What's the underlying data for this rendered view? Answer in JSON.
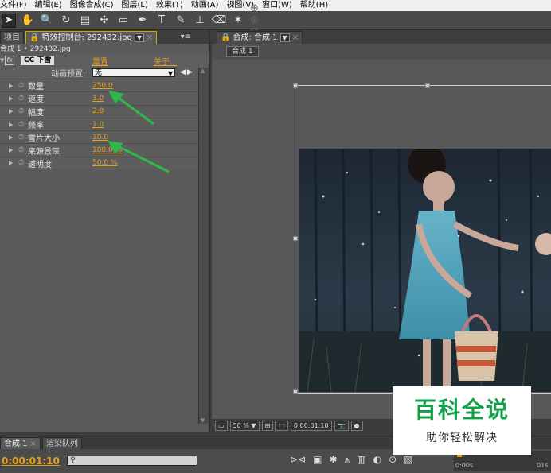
{
  "menu": [
    "文件(F)",
    "编辑(E)",
    "图像合成(C)",
    "图层(L)",
    "效果(T)",
    "动画(A)",
    "视图(V)",
    "窗口(W)",
    "帮助(H)"
  ],
  "left_panel": {
    "tab_project": "项目",
    "tab_effects": "特效控制台: 292432.jpg",
    "subtitle": "合成 1 • 292432.jpg",
    "fx_label": "fx",
    "effect_name": "CC 下雪",
    "reset": "重置",
    "about": "关于...",
    "preset_label": "动画预置:",
    "preset_value": "无",
    "properties": [
      {
        "name": "数量",
        "value": "250.0"
      },
      {
        "name": "速度",
        "value": "1.0"
      },
      {
        "name": "幅度",
        "value": "2.0"
      },
      {
        "name": "频率",
        "value": "1.0"
      },
      {
        "name": "雪片大小",
        "value": "10.0"
      },
      {
        "name": "来源景深",
        "value": "100.0 %"
      },
      {
        "name": "透明度",
        "value": "50.0 %"
      }
    ]
  },
  "comp_panel": {
    "tab": "合成: 合成 1",
    "sub_tab": "合成 1",
    "zoom": "50 %",
    "timecode": "0:00:01:10"
  },
  "timeline": {
    "tab_comp": "合成 1",
    "tab_render": "渲染队列",
    "timecode": "0:00:01:10",
    "ruler_start": "0:00s",
    "ruler_end": "01s"
  },
  "watermark": {
    "title": "百科全说",
    "subtitle": "助你轻松解决"
  },
  "colors": {
    "accent_value": "#e6a020",
    "watermark_green": "#14a04a",
    "arrow_green": "#2fb84a"
  }
}
